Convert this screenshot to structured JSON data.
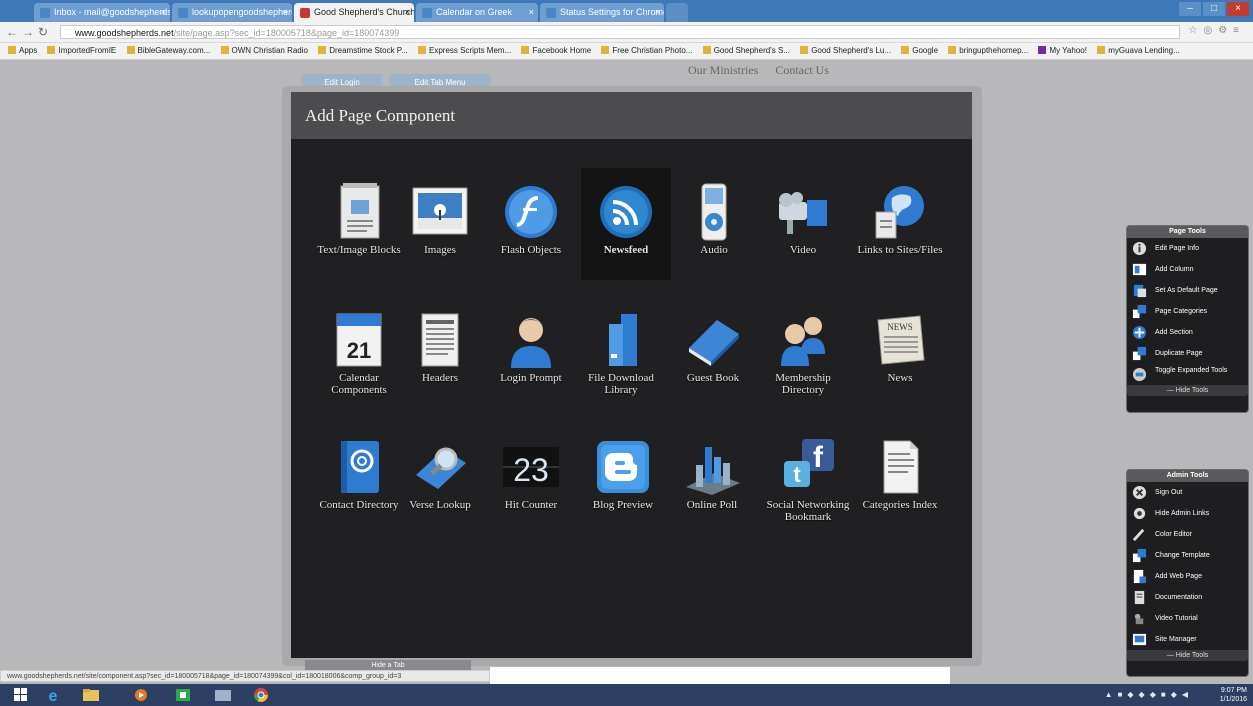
{
  "browser": {
    "tabs": [
      {
        "label": "Inbox - mail@goodshepherds...",
        "active": false
      },
      {
        "label": "lookupopengoodshepherds...",
        "active": false
      },
      {
        "label": "Good Shepherd's Church",
        "active": true
      },
      {
        "label": "Calendar on Greek",
        "active": false
      },
      {
        "label": "Status Settings for Chrome",
        "active": false
      }
    ],
    "url_main": "www.goodshepherds.net",
    "url_rest": "/site/page.asp?sec_id=180005718&page_id=180074399",
    "bookmarks": [
      "Apps",
      "ImportedFromIE",
      "BibleGateway.com...",
      "OWN Christian Radio",
      "Dreamstime Stock P...",
      "Express Scripts Mem...",
      "Facebook Home",
      "Free Christian Photo...",
      "Good Shepherd's S...",
      "Good Shepherd's Lu...",
      "Google",
      "bringupthehomep...",
      "My Yahoo!",
      "myGuava Lending..."
    ]
  },
  "site": {
    "nav_links": [
      "Our Ministries",
      "Contact Us"
    ],
    "bg_tabs": [
      "Edit Login",
      "Edit Tab Menu"
    ],
    "bottom_tab": "Hide a Tab"
  },
  "modal": {
    "title": "Add Page Component",
    "components": [
      {
        "label": "Text/Image Blocks",
        "icon": "text-image-blocks-icon"
      },
      {
        "label": "Images",
        "icon": "images-icon"
      },
      {
        "label": "Flash Objects",
        "icon": "flash-icon"
      },
      {
        "label": "Newsfeed",
        "icon": "rss-icon",
        "selected": true
      },
      {
        "label": "Audio",
        "icon": "audio-player-icon"
      },
      {
        "label": "Video",
        "icon": "video-camera-icon"
      },
      {
        "label": "Links to Sites/Files",
        "icon": "globe-icon"
      },
      {
        "label": "Calendar Components",
        "icon": "calendar-icon",
        "calendar_day": "21"
      },
      {
        "label": "Headers",
        "icon": "document-icon"
      },
      {
        "label": "Login Prompt",
        "icon": "user-icon"
      },
      {
        "label": "File Download Library",
        "icon": "file-binder-icon"
      },
      {
        "label": "Guest Book",
        "icon": "book-icon"
      },
      {
        "label": "Membership Directory",
        "icon": "users-icon"
      },
      {
        "label": "News",
        "icon": "newspaper-icon",
        "newspaper_text": "NEWS"
      },
      {
        "label": "Contact Directory",
        "icon": "address-book-icon"
      },
      {
        "label": "Verse Lookup",
        "icon": "magnifier-book-icon"
      },
      {
        "label": "Hit Counter",
        "icon": "counter-icon",
        "counter_digits": "23"
      },
      {
        "label": "Blog Preview",
        "icon": "blogger-icon"
      },
      {
        "label": "Online Poll",
        "icon": "bar-chart-icon"
      },
      {
        "label": "Social Networking Bookmark",
        "icon": "social-icon"
      },
      {
        "label": "Categories Index",
        "icon": "index-page-icon"
      }
    ]
  },
  "page_tools": {
    "title": "Page Tools",
    "items": [
      "Edit Page Info",
      "Add Column",
      "Set As Default Page",
      "Page Categories",
      "Add Section",
      "Duplicate Page",
      "Toggle Expanded Tools"
    ],
    "footer": "Hide Tools"
  },
  "admin_tools": {
    "title": "Admin Tools",
    "items": [
      "Sign Out",
      "Hide Admin Links",
      "Color Editor",
      "Change Template",
      "Add Web Page",
      "Documentation",
      "Video Tutorial",
      "Site Manager"
    ],
    "footer": "Hide Tools"
  },
  "status_url": "www.goodshepherds.net/site/component.asp?sec_id=180005718&page_id=180074399&col_id=180018006&comp_group_id=3",
  "taskbar": {
    "time": "9:07 PM",
    "date": "1/1/2016"
  },
  "colors": {
    "modal_bg": "#202022",
    "modal_header": "#4c4c4e",
    "tab_bar": "#3f78b8",
    "taskbar": "#2d3f63"
  }
}
